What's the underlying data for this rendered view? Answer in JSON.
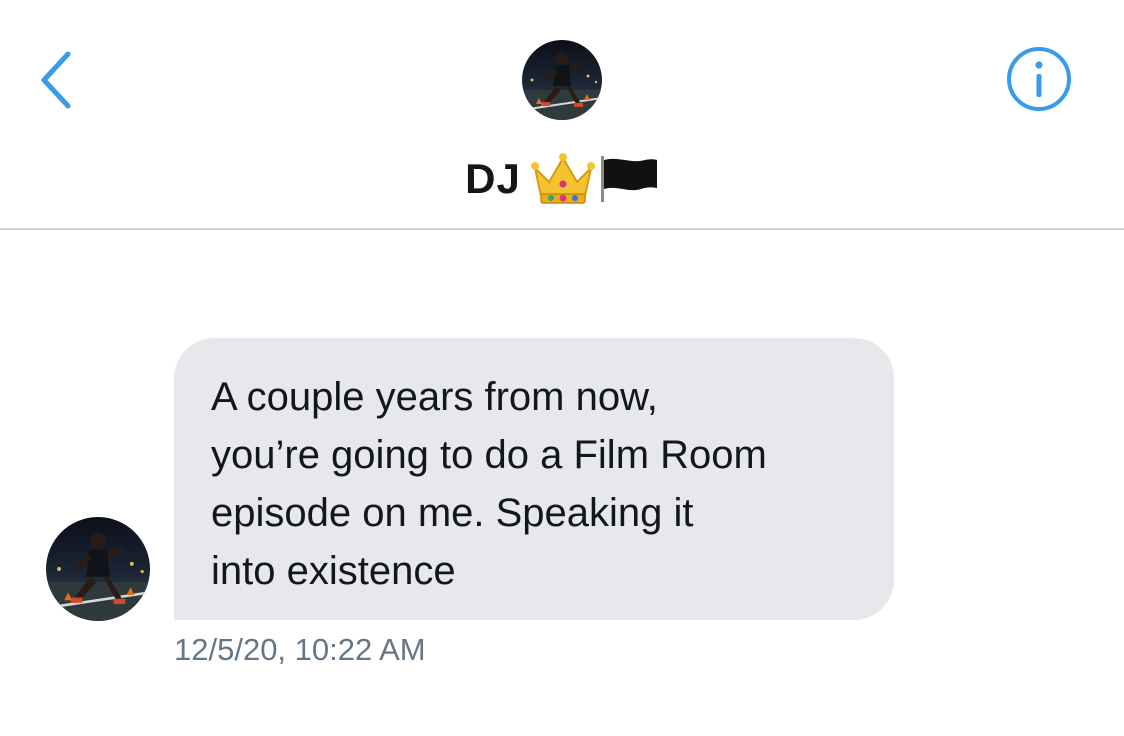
{
  "header": {
    "contact_name": "DJ",
    "name_emojis": [
      "crown-emoji",
      "black-flag-emoji"
    ],
    "back_icon": "chevron-left-icon",
    "info_icon": "info-circle-icon",
    "avatar": "athlete-photo"
  },
  "conversation": {
    "messages": [
      {
        "sender": "DJ",
        "text_lines": [
          "A couple years from now,",
          "you’re going to do a Film Room",
          "episode on me. Speaking it",
          "into existence"
        ],
        "timestamp": "12/5/20, 10:22 AM"
      }
    ]
  },
  "colors": {
    "accent": "#3a9bea",
    "bubble_bg": "#e6e8eb",
    "text": "#14171a",
    "timestamp": "#657786",
    "divider": "#d2d3d6"
  }
}
